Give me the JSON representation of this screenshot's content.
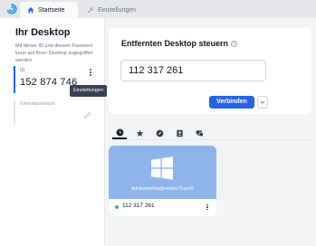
{
  "tabs": [
    {
      "label": "Startseite",
      "icon": "home-icon",
      "active": true
    },
    {
      "label": "Einstellungen",
      "icon": "wrench-icon",
      "active": false
    }
  ],
  "sidebar": {
    "title": "Ihr Desktop",
    "description": "Mit dieser ID und diesem Passwort kann auf Ihren Desktop zugegriffen werden.",
    "id_label": "ID",
    "id_value": "152 874 746",
    "tooltip": "Einstellungen",
    "password_label": "Einmalpasswort"
  },
  "remote": {
    "title": "Entfernten Desktop steuern",
    "input_value": "112 317 261",
    "connect_label": "Verbinden"
  },
  "peer_tabs": [
    "recent-icon",
    "favorites-icon",
    "discovered-icon",
    "address-book-icon",
    "group-icon"
  ],
  "peer": {
    "name": "AdrillamariRai@elektro73-pc05",
    "id": "112 317 261",
    "status": "online"
  },
  "colors": {
    "accent": "#2563eb",
    "thumbnail": "#8fb4ec",
    "online": "#22c55e"
  }
}
